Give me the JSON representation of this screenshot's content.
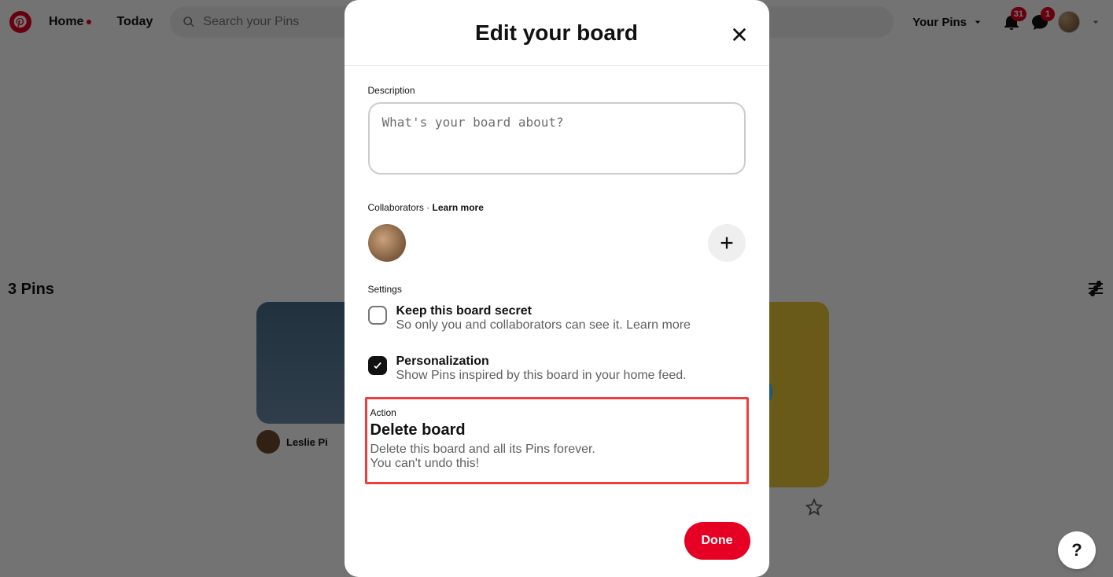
{
  "header": {
    "nav": {
      "home": "Home",
      "today": "Today"
    },
    "search_placeholder": "Search your Pins",
    "your_pins": "Your Pins",
    "notifications_count": "31",
    "messages_count": "1"
  },
  "page": {
    "pin_count_label": "3 Pins",
    "pin_author": "Leslie Pi"
  },
  "modal": {
    "title": "Edit your board",
    "description_label": "Description",
    "description_placeholder": "What's your board about?",
    "collab_label": "Collaborators",
    "collab_sep": " · ",
    "learn_more": "Learn more",
    "settings_label": "Settings",
    "secret": {
      "title": "Keep this board secret",
      "sub": "So only you and collaborators can see it. Learn more",
      "checked": false
    },
    "personalization": {
      "title": "Personalization",
      "sub": "Show Pins inspired by this board in your home feed.",
      "checked": true
    },
    "action_label": "Action",
    "delete_title": "Delete board",
    "delete_sub_1": "Delete this board and all its Pins forever.",
    "delete_sub_2": "You can't undo this!",
    "done": "Done"
  },
  "help": "?"
}
